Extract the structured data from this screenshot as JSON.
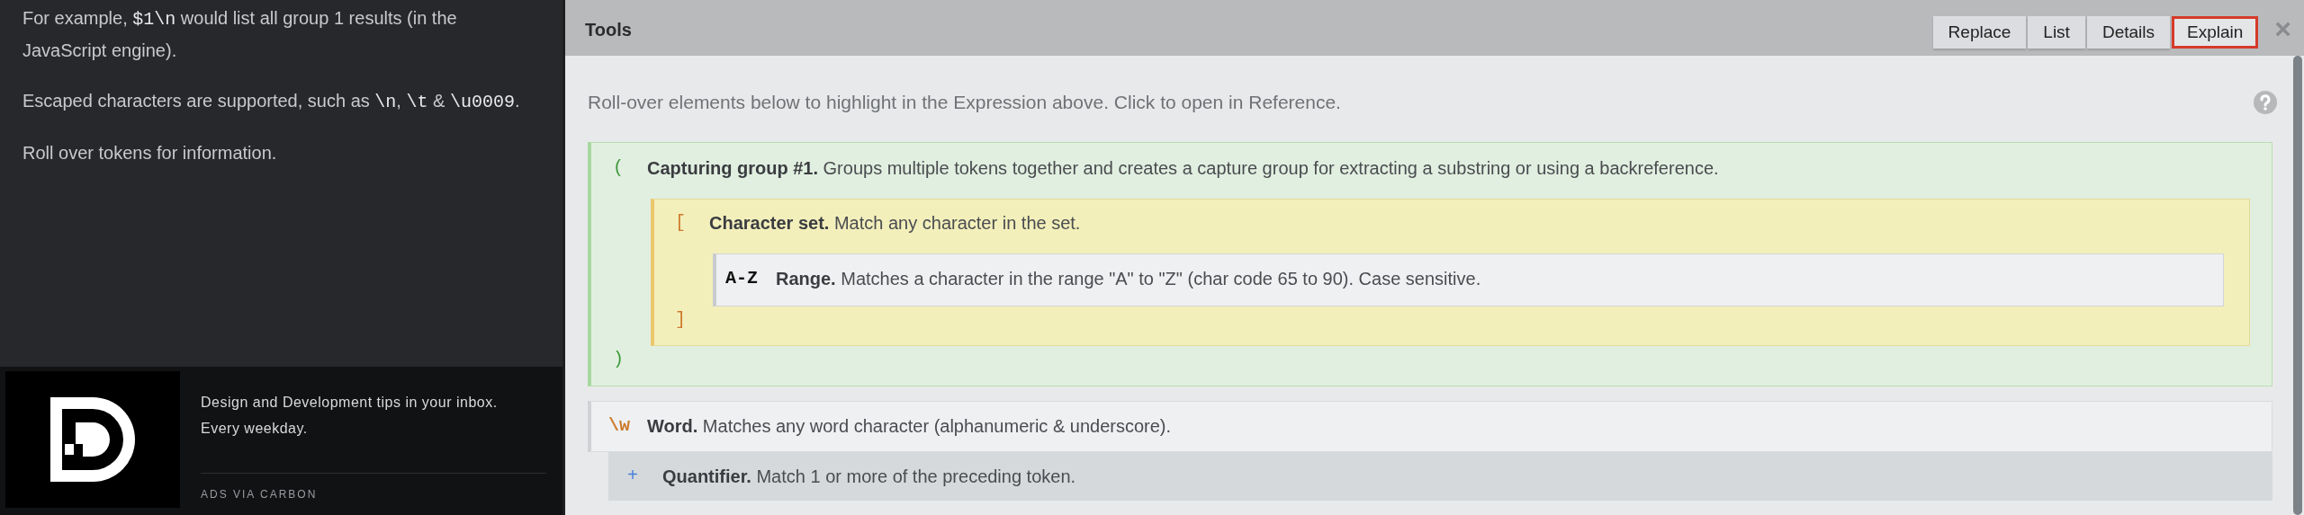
{
  "sidebar": {
    "paragraphs": [
      [
        {
          "kind": "text",
          "text": "For example, "
        },
        {
          "kind": "code",
          "text": "$1\\n"
        },
        {
          "kind": "text",
          "text": " would list all group 1 results (in the JavaScript engine)."
        }
      ],
      [
        {
          "kind": "text",
          "text": "Escaped characters are supported, such as "
        },
        {
          "kind": "code",
          "text": "\\n"
        },
        {
          "kind": "text",
          "text": ", "
        },
        {
          "kind": "code",
          "text": "\\t"
        },
        {
          "kind": "text",
          "text": " & "
        },
        {
          "kind": "code",
          "text": "\\u0009"
        },
        {
          "kind": "text",
          "text": "."
        }
      ],
      [
        {
          "kind": "text",
          "text": "Roll over tokens for information."
        }
      ]
    ]
  },
  "ad": {
    "text": "Design and Development tips in your inbox. Every weekday.",
    "footer": "ADS VIA CARBON"
  },
  "tools": {
    "title": "Tools",
    "buttons": [
      {
        "label": "Replace",
        "selected": false
      },
      {
        "label": "List",
        "selected": false
      },
      {
        "label": "Details",
        "selected": false
      },
      {
        "label": "Explain",
        "selected": true
      }
    ],
    "close": "×",
    "intro": "Roll-over elements below to highlight in the Expression above. Click to open in Reference.",
    "tokens": [
      {
        "kind": "group",
        "token": "(",
        "close": ")",
        "name": "Capturing group #1.",
        "description": "Groups multiple tokens together and creates a capture group for extracting a substring or using a backreference.",
        "children": [
          {
            "kind": "set",
            "token": "[",
            "close": "]",
            "name": "Character set.",
            "description": "Match any character in the set.",
            "children": [
              {
                "kind": "range",
                "token": "A-Z",
                "name": "Range.",
                "description": "Matches a character in the range \"A\" to \"Z\" (char code 65 to 90). Case sensitive."
              }
            ]
          }
        ]
      },
      {
        "kind": "word",
        "token": "\\w",
        "name": "Word.",
        "description": "Matches any word character (alphanumeric & underscore)."
      },
      {
        "kind": "quantifier",
        "token": "+",
        "name": "Quantifier.",
        "description": "Match 1 or more of the preceding token."
      }
    ]
  }
}
